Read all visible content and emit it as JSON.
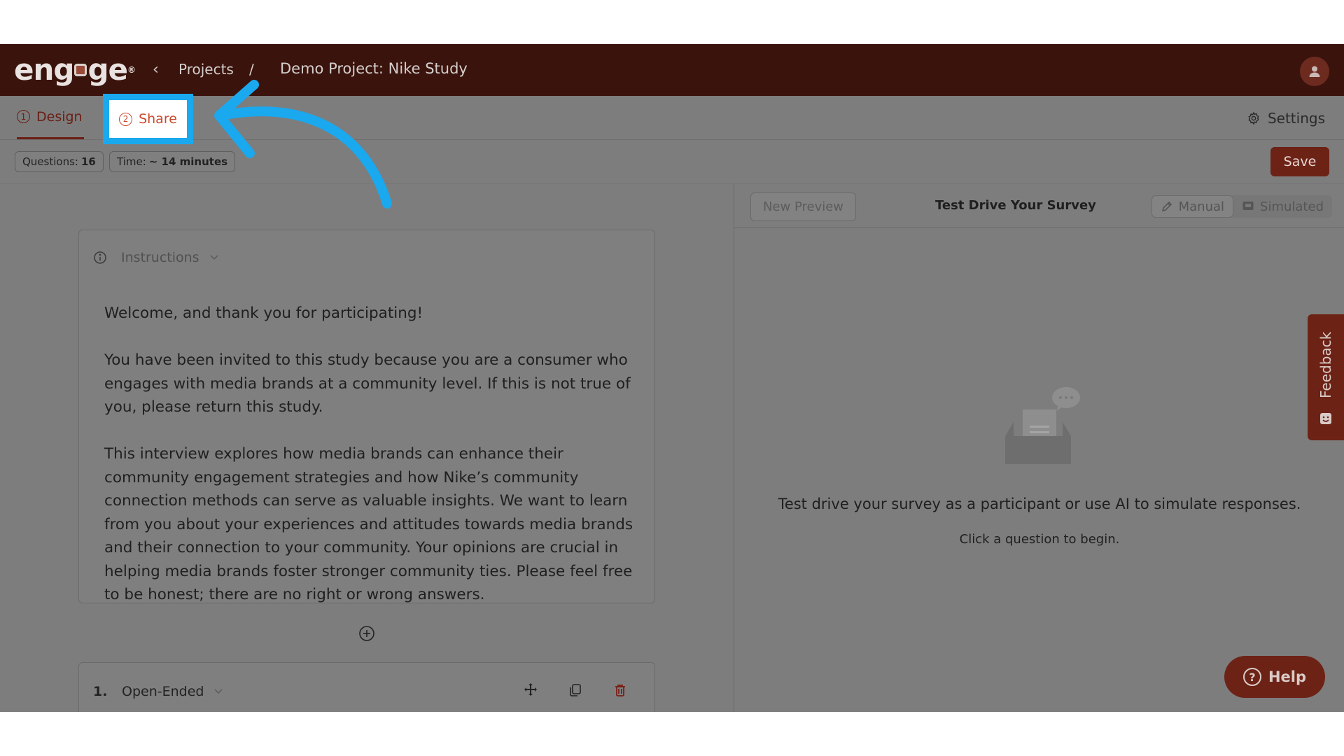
{
  "header": {
    "logo_text": "engage",
    "breadcrumb_projects": "Projects",
    "breadcrumb_sep": "/",
    "project_title": "Demo Project: Nike Study"
  },
  "tabs": {
    "design": {
      "num": "1",
      "label": "Design"
    },
    "share": {
      "num": "2",
      "label": "Share"
    },
    "settings_label": "Settings"
  },
  "stats": {
    "questions_label": "Questions:",
    "questions_value": "16",
    "time_label": "Time:",
    "time_value": "~ 14 minutes",
    "save_label": "Save"
  },
  "instructions": {
    "label": "Instructions",
    "paragraphs": [
      "Welcome, and thank you for participating!",
      "You have been invited to this study because you are a consumer who engages with media brands at a community level. If this is not true of you, please return this study.",
      "This interview explores how media brands can enhance their community engagement strategies and how Nike’s community connection methods can serve as valuable insights. We want to learn from you about your experiences and attitudes towards media brands and their connection to your community. Your opinions are crucial in helping media brands foster stronger community ties. Please feel free to be honest; there are no right or wrong answers."
    ]
  },
  "question1": {
    "number": "1.",
    "type": "Open-Ended"
  },
  "preview": {
    "new_preview_label": "New Preview",
    "title": "Test Drive Your Survey",
    "mode_manual": "Manual",
    "mode_simulated": "Simulated",
    "empty_message": "Test drive your survey as a participant or use AI to simulate responses.",
    "empty_hint": "Click a question to begin."
  },
  "feedback_label": "Feedback",
  "help_label": "Help",
  "colors": {
    "brand": "#6d2216",
    "header_bg": "#3a130c",
    "overlay_gray": "#7d7d7d",
    "highlight_blue": "#1aa8ee",
    "share_text": "#c9492d"
  }
}
